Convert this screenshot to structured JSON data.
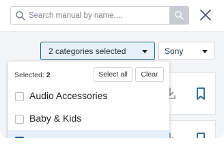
{
  "search": {
    "placeholder": "Search manual by name....",
    "value": ""
  },
  "filters": {
    "category_label": "2 categories selected",
    "brand_label": "Sony"
  },
  "dropdown": {
    "selected_prefix": "Selected: ",
    "selected_count": "2",
    "select_all_label": "Select all",
    "clear_label": "Clear",
    "options": [
      {
        "label": "Audio Accessories",
        "checked": false
      },
      {
        "label": "Baby & Kids",
        "checked": false
      },
      {
        "label": "",
        "checked": true
      }
    ]
  },
  "colors": {
    "accent": "#1f5f8b",
    "selected_bg": "#e8f1fa",
    "search_button_bg": "#c7ccd3"
  },
  "icons": {
    "search": "search-icon",
    "close": "close-icon",
    "download": "download-icon",
    "bookmark": "bookmark-icon"
  }
}
